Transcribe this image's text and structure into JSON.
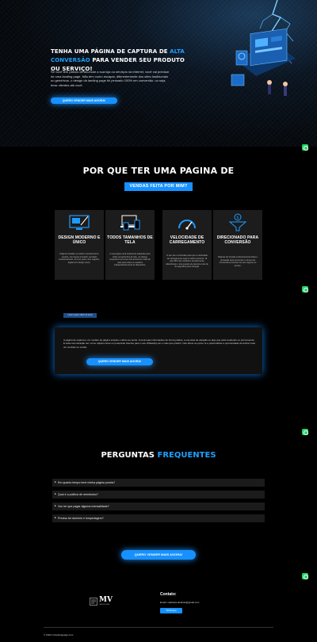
{
  "hero": {
    "title_part1": "Tenha uma página de captura de ",
    "title_accent": "alta conversão",
    "title_part2": " para vender seu produto ou serviço!",
    "text": "Se você tem planos de anunciar a sua loja ou serviços na Internet, você vai precisar de uma landing page. Não tem como escapar, diferentemente dos sites tradicionais ou genéricos, o design da landing page foi pensado 100% em conversão, ou seja, levar clientes até você.",
    "button": "Quero vender mais agora!"
  },
  "why": {
    "title": "Por que ter uma pagina de",
    "subtitle": "vendas feita por mim?",
    "cards": [
      {
        "icon": "design-monitor-icon",
        "title": "Design moderno e único",
        "desc": "Páginas focadas na melhor experiência do usuário, com layout inovador, pensado exclusivamente, do zero para o seu negócio, digital com design único."
      },
      {
        "icon": "devices-icon",
        "title": "Todos tamanhos de tela",
        "desc": "A sua página será totalmente adaptada para todos os tamanhos de tela, um design responsivo torna seu site acessível e fácil de usar para todos os usuários independentemente do dispositivo."
      },
      {
        "icon": "speedometer-icon",
        "title": "Velocidade de carregamento",
        "desc": "O seu site é otimizado para que a velocidade de carregamento seja a melhor possível. Já que 53% dos visitantes simplesmente abandonam o site quando ele demora mais de 3s segundos para carregar."
      },
      {
        "icon": "funnel-icon",
        "title": "Direcionado para conversão",
        "desc": "Páginas de Vendas exclusivamente feitas e pensadas para aumentar o número de conversões possíveis ao seu negócio ou serviço."
      }
    ]
  },
  "info": {
    "tag": "Lorem ipsum dolor sit amet",
    "text": "A página de captura é um modelo de página simples e direto ao ponto. Ai terá suas informações de forma prática, a sua área de atuação ou algo que está vendendo ou promovendo. E toda comunicação tem como objetivo levar os potenciais clientes para o seu WhatsApp ao e mais que preferir, indo direto ao ponto. E é potencializar a oportunidade de fechar mais um contrato ou venda.",
    "button": "Quero vender mais agora!"
  },
  "faq": {
    "title": "Perguntas",
    "title_accent": "Frequentes",
    "items": [
      "Em quanto tempo terei minha página pronta?",
      "Qual é a política de reembolso?",
      "Vou ter que pagar alguma mensalidade?",
      "Preciso ter domínio e hospedagem?"
    ],
    "button": "Quero vender mais agora!"
  },
  "footer": {
    "logo_text": "MV",
    "logo_sub": "LANDING PAGE",
    "contact_title": "Contato:",
    "email": "Email: mathews.alcantar@gmail.com",
    "whatsapp_button": "WhatsApp",
    "copyright": "© 2022 mvlandingpage.com"
  },
  "colors": {
    "accent": "#1691ff",
    "whatsapp": "#25d366",
    "card_bg": "#1c1c1c"
  }
}
